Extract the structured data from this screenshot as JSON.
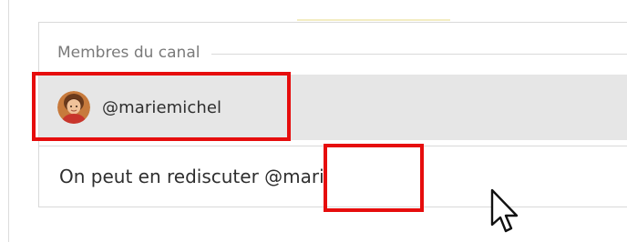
{
  "channel_members": {
    "section_title": "Membres du canal",
    "suggestions": [
      {
        "handle": "@mariemichel",
        "avatar_icon": "user-avatar-photo"
      }
    ]
  },
  "composer": {
    "text_before_mention": "On peut en rediscuter ",
    "mention_query": "@mari"
  },
  "colors": {
    "highlight": "#e60d0d",
    "suggestion_bg": "#e6e6e6",
    "border": "#d9d9d9",
    "section_title": "#7a7a7a"
  },
  "pointer_icon": "arrow-cursor-icon"
}
